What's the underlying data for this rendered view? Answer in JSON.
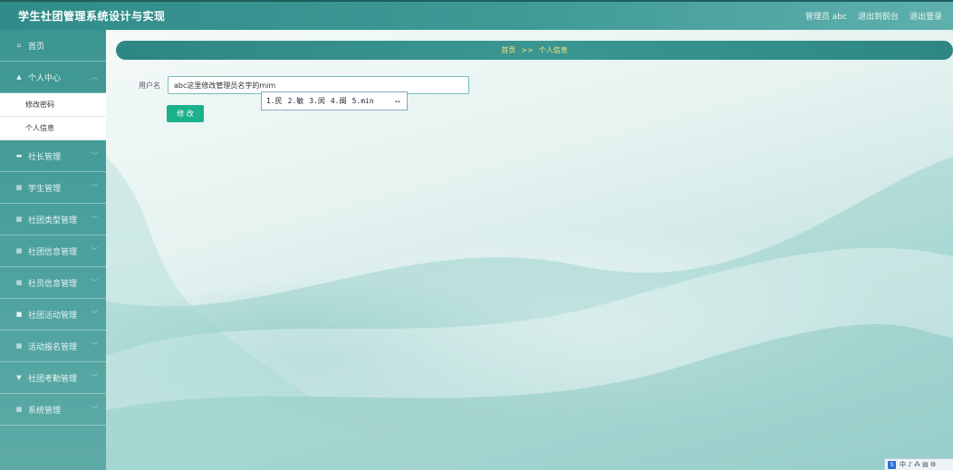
{
  "header": {
    "title": "学生社团管理系统设计与实现",
    "admin_label": "管理员 abc",
    "back_to_front": "退出到前台",
    "logout": "退出登录"
  },
  "sidebar": {
    "items": [
      {
        "label": "首页",
        "icon": "home-icon",
        "glyph": "⌂"
      },
      {
        "label": "个人中心",
        "icon": "user-icon",
        "glyph": "▲"
      },
      {
        "label": "社长管理",
        "icon": "monitor-icon",
        "glyph": "▬"
      },
      {
        "label": "学生管理",
        "icon": "grid-icon",
        "glyph": "▦"
      },
      {
        "label": "社团类型管理",
        "icon": "grid-icon",
        "glyph": "▦"
      },
      {
        "label": "社团信息管理",
        "icon": "grid-icon",
        "glyph": "▦"
      },
      {
        "label": "社员信息管理",
        "icon": "grid-icon",
        "glyph": "▦"
      },
      {
        "label": "社团活动管理",
        "icon": "clipboard-icon",
        "glyph": "■"
      },
      {
        "label": "活动报名管理",
        "icon": "grid-icon",
        "glyph": "▦"
      },
      {
        "label": "社团考勤管理",
        "icon": "trophy-icon",
        "glyph": "▼"
      },
      {
        "label": "系统管理",
        "icon": "grid-icon",
        "glyph": "▦"
      }
    ],
    "submenu": [
      {
        "label": "修改密码"
      },
      {
        "label": "个人信息"
      }
    ]
  },
  "breadcrumb": {
    "home": "首页",
    "separator": ">>",
    "current": "个人信息"
  },
  "form": {
    "username_label": "用户名",
    "username_value": "abc这里修改管理员名字的mim",
    "submit_label": "修 改"
  },
  "ime": {
    "candidates": [
      "1.民",
      "2.敏",
      "3.闵",
      "4.闽",
      "5.min"
    ],
    "arrows": "◂▸"
  },
  "tray": {
    "logo": "S",
    "text": "中 ♪ ⁂ ▤ ⚙"
  },
  "colors": {
    "topbar": "#3f9a96",
    "sidebar": "#4aa09d",
    "breadcrumb_text": "#f4e37a",
    "submit_button": "#19b28b"
  }
}
